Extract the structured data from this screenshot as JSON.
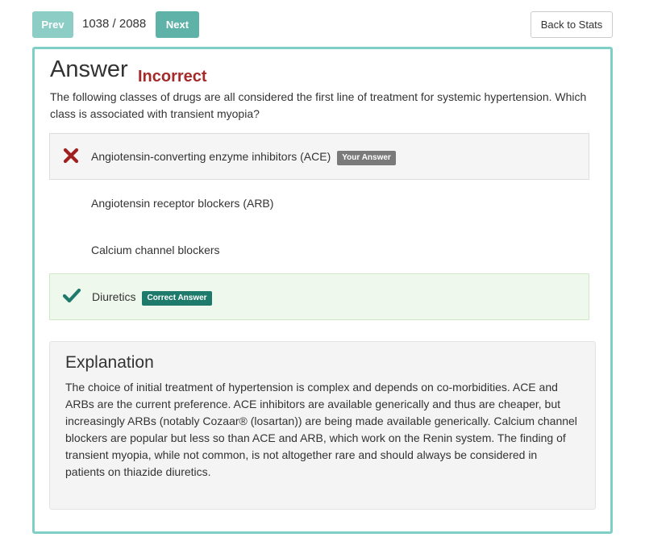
{
  "nav": {
    "prev_label": "Prev",
    "counter": "1038 / 2088",
    "next_label": "Next",
    "back_label": "Back to Stats"
  },
  "answer": {
    "title": "Answer",
    "result": "Incorrect",
    "question": "The following classes of drugs are all considered the first line of treatment for systemic hypertension. Which class is associated with transient myopia?",
    "choices": [
      {
        "label": "Angiotensin-converting enzyme inhibitors (ACE)",
        "badge": "Your Answer",
        "state": "wrong",
        "icon": "x-icon"
      },
      {
        "label": "Angiotensin receptor blockers (ARB)",
        "badge": "",
        "state": "neutral",
        "icon": ""
      },
      {
        "label": "Calcium channel blockers",
        "badge": "",
        "state": "neutral",
        "icon": ""
      },
      {
        "label": "Diuretics",
        "badge": "Correct Answer",
        "state": "correct",
        "icon": "checkmark-icon"
      }
    ]
  },
  "explanation": {
    "title": "Explanation",
    "text": "The choice of initial treatment of hypertension is complex and depends on co-morbidities. ACE and ARBs are the current preference. ACE inhibitors are available generically and thus are cheaper, but increasingly ARBs (notably Cozaar® (losartan)) are being made available generically. Calcium channel blockers are popular but less so than ACE and ARB, which work on the Renin system. The finding of transient myopia, while not common, is not altogether rare and should always be considered in patients on thiazide diuretics."
  },
  "colors": {
    "accent": "#7ecfc6",
    "incorrect": "#a52a2a",
    "wrong_mark": "#a02020",
    "correct_mark": "#1e7a6b"
  }
}
